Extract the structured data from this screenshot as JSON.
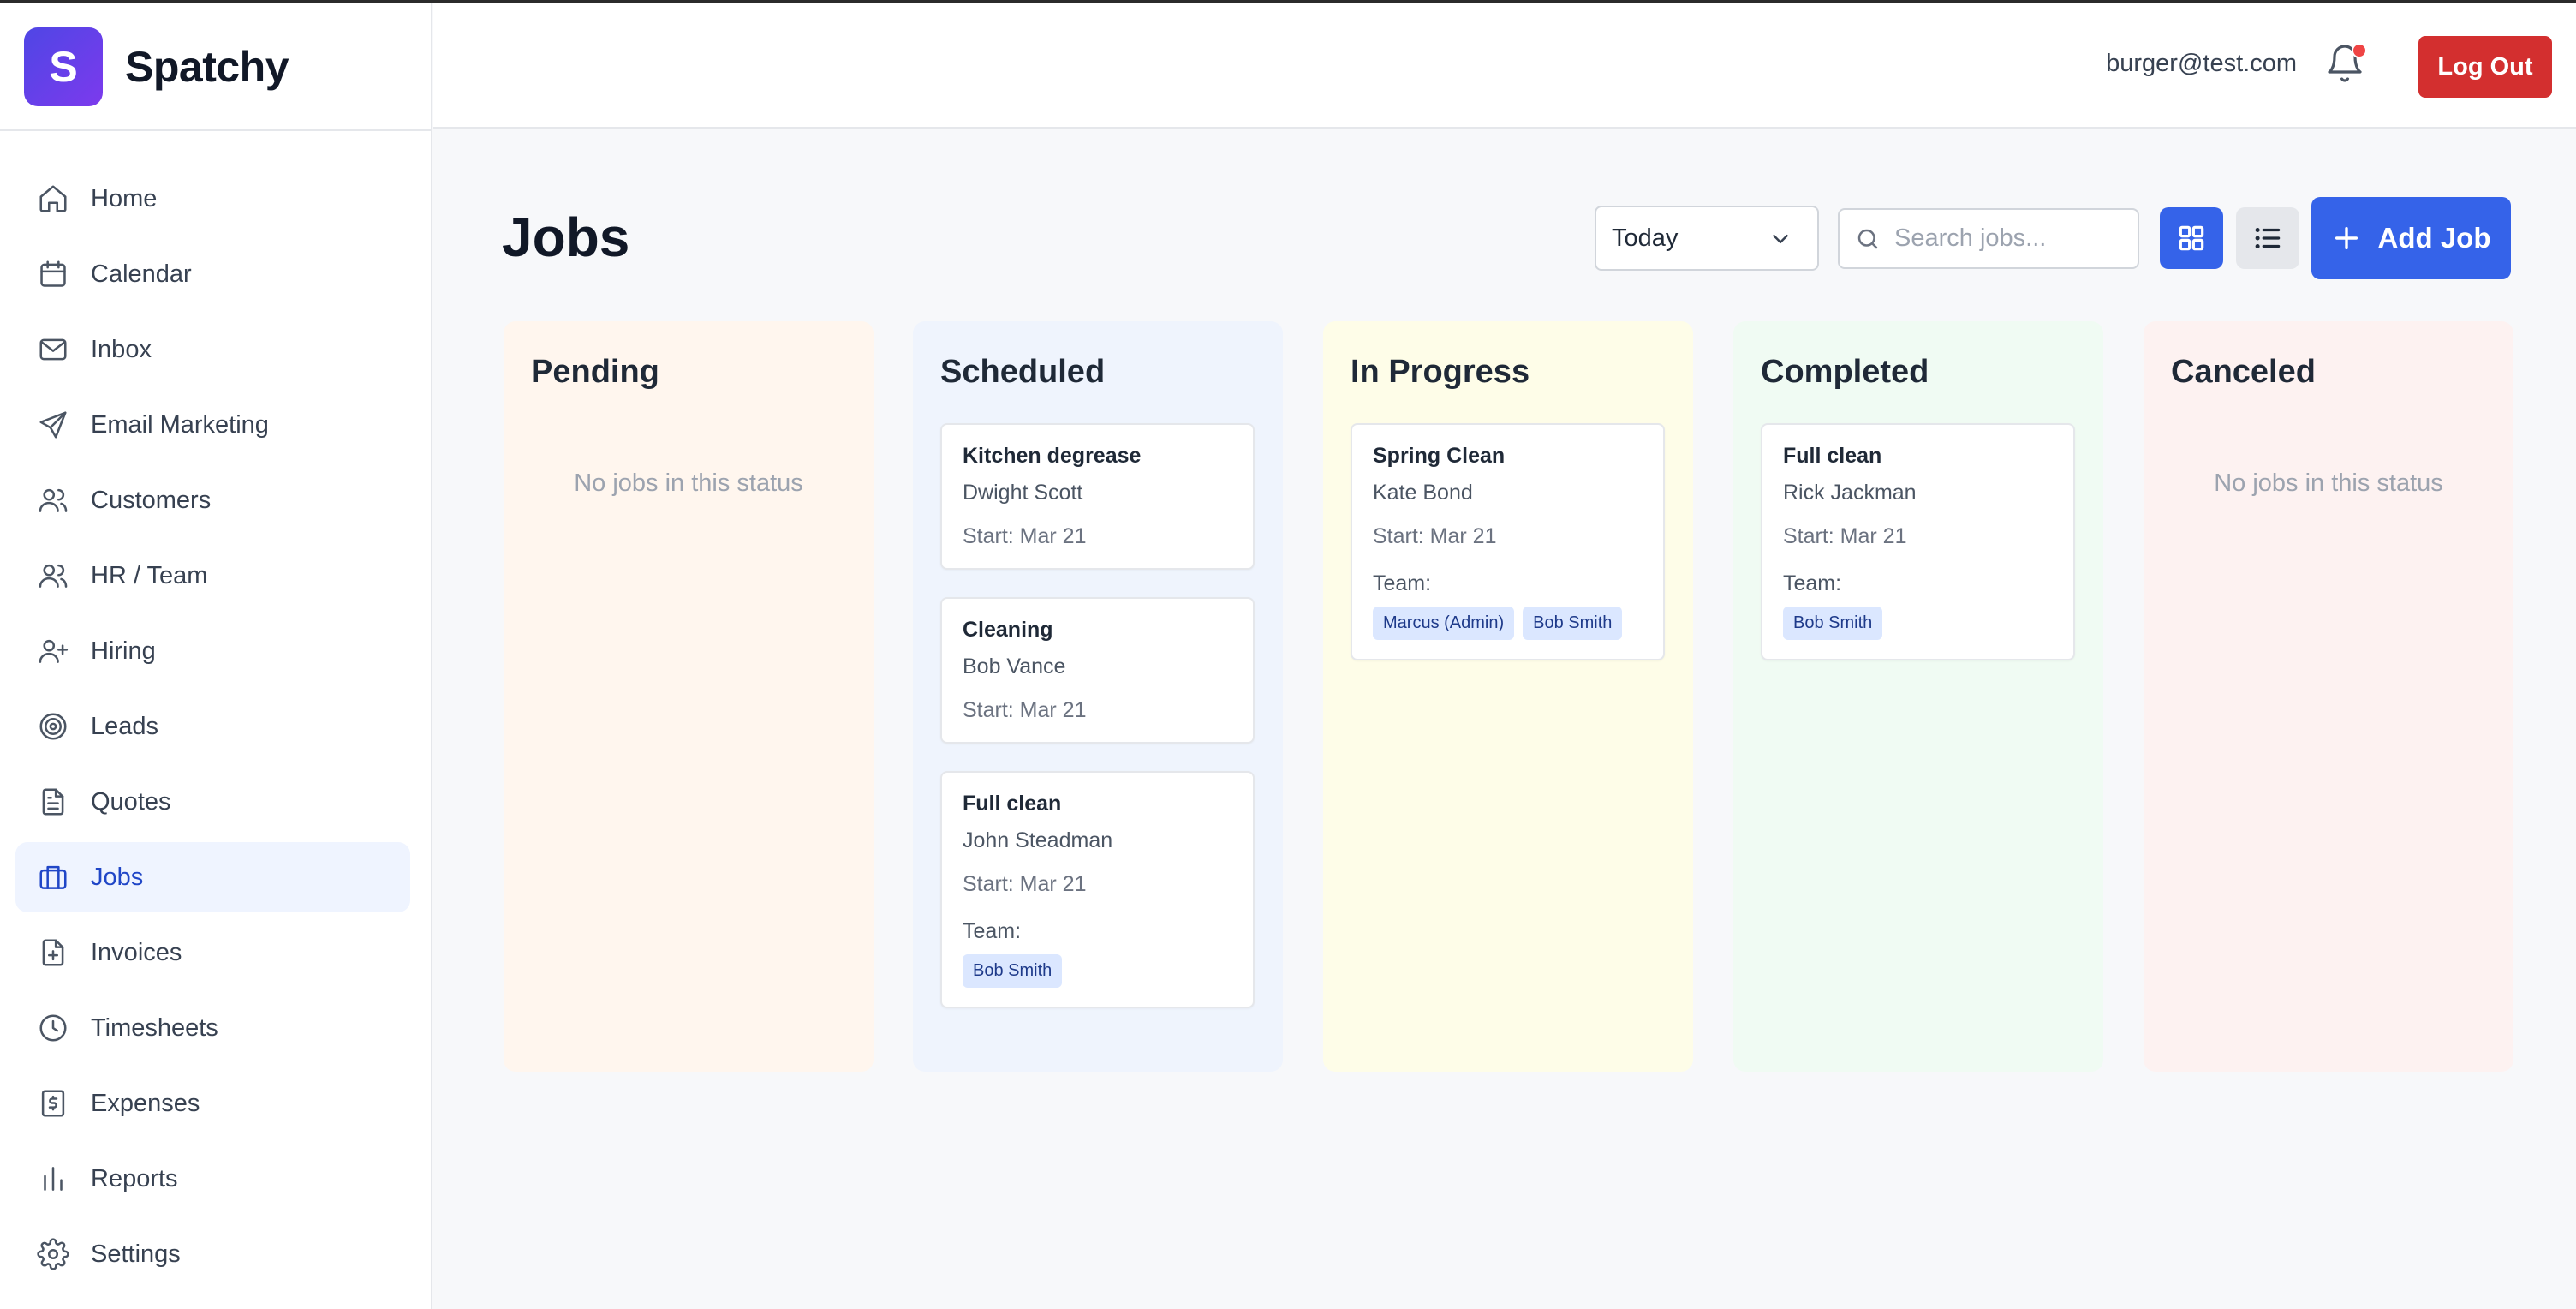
{
  "app": {
    "logo_letter": "S",
    "name": "Spatchy"
  },
  "sidebar": {
    "items": [
      {
        "label": "Home",
        "icon": "home-icon"
      },
      {
        "label": "Calendar",
        "icon": "calendar-icon"
      },
      {
        "label": "Inbox",
        "icon": "mail-icon"
      },
      {
        "label": "Email Marketing",
        "icon": "send-icon"
      },
      {
        "label": "Customers",
        "icon": "users-icon"
      },
      {
        "label": "HR / Team",
        "icon": "users-icon"
      },
      {
        "label": "Hiring",
        "icon": "user-plus-icon"
      },
      {
        "label": "Leads",
        "icon": "target-icon"
      },
      {
        "label": "Quotes",
        "icon": "file-text-icon"
      },
      {
        "label": "Jobs",
        "icon": "briefcase-icon",
        "active": true
      },
      {
        "label": "Invoices",
        "icon": "file-plus-icon"
      },
      {
        "label": "Timesheets",
        "icon": "clock-icon"
      },
      {
        "label": "Expenses",
        "icon": "receipt-icon"
      },
      {
        "label": "Reports",
        "icon": "bar-chart-icon"
      },
      {
        "label": "Settings",
        "icon": "gear-icon"
      }
    ]
  },
  "header": {
    "user_email": "burger@test.com",
    "logout_label": "Log Out",
    "has_notification": true
  },
  "main": {
    "title": "Jobs",
    "date_filter": "Today",
    "search_placeholder": "Search jobs...",
    "add_job_label": "Add Job"
  },
  "columns": [
    {
      "title": "Pending",
      "empty_text": "No jobs in this status",
      "cards": []
    },
    {
      "title": "Scheduled",
      "cards": [
        {
          "title": "Kitchen degrease",
          "client": "Dwight Scott",
          "start": "Start: Mar 21"
        },
        {
          "title": "Cleaning",
          "client": "Bob Vance",
          "start": "Start: Mar 21"
        },
        {
          "title": "Full clean",
          "client": "John Steadman",
          "start": "Start: Mar 21",
          "team_label": "Team:",
          "team": [
            "Bob Smith"
          ]
        }
      ]
    },
    {
      "title": "In Progress",
      "cards": [
        {
          "title": "Spring Clean",
          "client": "Kate Bond",
          "start": "Start: Mar 21",
          "team_label": "Team:",
          "team": [
            "Marcus (Admin)",
            "Bob Smith"
          ]
        }
      ]
    },
    {
      "title": "Completed",
      "cards": [
        {
          "title": "Full clean",
          "client": "Rick Jackman",
          "start": "Start: Mar 21",
          "team_label": "Team:",
          "team": [
            "Bob Smith"
          ]
        }
      ]
    },
    {
      "title": "Canceled",
      "empty_text": "No jobs in this status",
      "cards": []
    }
  ],
  "colors": {
    "accent": "#3563e9",
    "logout": "#d32f2f",
    "pending_bg": "#fff6ee",
    "scheduled_bg": "#eff4fd",
    "in_progress_bg": "#fefde8",
    "completed_bg": "#f0fbf3",
    "canceled_bg": "#fdf2f1"
  }
}
